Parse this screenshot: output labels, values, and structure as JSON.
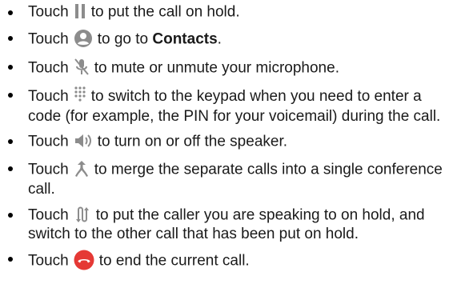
{
  "items": [
    {
      "before": "Touch",
      "icon": "pause-icon",
      "after": "to put the call on hold."
    },
    {
      "before": "Touch",
      "icon": "contact-icon",
      "after": "to go to ",
      "bold": "Contacts",
      "tail": "."
    },
    {
      "before": "Touch",
      "icon": "mute-microphone-icon",
      "after": "to mute or unmute your microphone."
    },
    {
      "before": "Touch",
      "icon": "keypad-icon",
      "after": "to switch to the keypad when you need to enter a code (for example, the PIN for your voicemail) during the call."
    },
    {
      "before": "Touch",
      "icon": "speaker-icon",
      "after": "to turn on or off the speaker."
    },
    {
      "before": "Touch",
      "icon": "merge-calls-icon",
      "after": "to merge the separate calls into a single conference call."
    },
    {
      "before": "Touch",
      "icon": "swap-calls-icon",
      "after": "to put the caller you are speaking to on hold, and switch to the other call that has been put on hold."
    },
    {
      "before": "Touch",
      "icon": "end-call-icon",
      "after": "to end the current call."
    }
  ],
  "colors": {
    "icon_gray": "#8c8c8c",
    "end_call_red": "#e53935"
  }
}
